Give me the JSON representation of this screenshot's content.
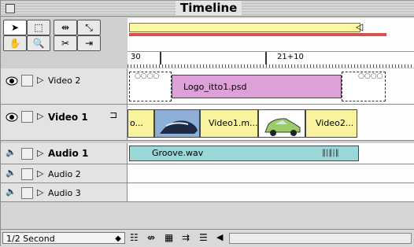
{
  "window": {
    "title": "Timeline"
  },
  "tools": [
    {
      "name": "select-tool",
      "glyph": "➤"
    },
    {
      "name": "marquee-tool",
      "glyph": "⬚"
    },
    {
      "name": "track-tool",
      "glyph": "⇹"
    },
    {
      "name": "link-tool",
      "glyph": "⤡"
    },
    {
      "name": "hand-tool",
      "glyph": "✋"
    },
    {
      "name": "zoom-tool",
      "glyph": "🔍"
    },
    {
      "name": "razor-tool",
      "glyph": "✂"
    },
    {
      "name": "edge-tool",
      "glyph": "⇥"
    }
  ],
  "ruler": {
    "start_label": "30",
    "mid_label": "21+10"
  },
  "tracks": {
    "video2": {
      "name": "Video 2",
      "clip_label": "Logo_itto1.psd"
    },
    "video1": {
      "name": "Video 1",
      "clip_partial": "o...",
      "clip_a": "Video1.m...",
      "clip_b": "Video2..."
    },
    "audio1": {
      "name": "Audio 1",
      "clip_label": "Groove.wav"
    },
    "audio2": {
      "name": "Audio 2"
    },
    "audio3": {
      "name": "Audio 3"
    }
  },
  "status": {
    "time_unit": "1/2 Second"
  },
  "colors": {
    "video2_clip": "#dda0d8",
    "video1_clip": "#f9f39e",
    "audio_clip": "#9ad8d8",
    "work_area": "#fbf7a3",
    "render_bar": "#d85050"
  }
}
